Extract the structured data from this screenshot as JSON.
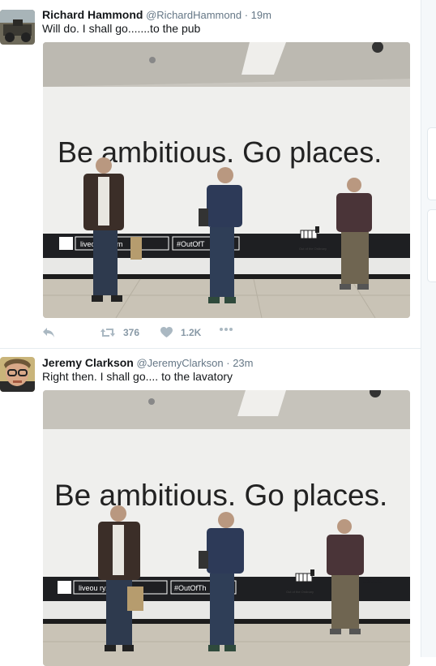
{
  "tweets": [
    {
      "fullname": "Richard Hammond",
      "username": "@RichardHammond",
      "separator": "·",
      "time": "19m",
      "text": "Will do. I shall go.......to the pub",
      "photo_sign_text": "Be ambitious. Go places.",
      "photo_panel_text": "liveou    ry.com",
      "photo_hashtag_text": "#OutOfT",
      "photo_brand_text": "estec",
      "photo_brand_tagline": "Out of the Ordinary",
      "actions": {
        "reply_icon": "reply-icon",
        "retweet_icon": "retweet-icon",
        "retweet_count": "376",
        "like_icon": "heart-icon",
        "like_count": "1.2K",
        "more_icon": "more-dots-icon"
      }
    },
    {
      "fullname": "Jeremy Clarkson",
      "username": "@JeremyClarkson",
      "separator": "·",
      "time": "23m",
      "text": "Right then. I shall go.... to the lavatory",
      "photo_sign_text": "Be ambitious. Go places.",
      "photo_panel_text": "liveou    ry.com",
      "photo_hashtag_text": "#OutOfTh",
      "photo_brand_text": "estec",
      "photo_brand_tagline": "Out of the Ordinary"
    }
  ],
  "colors": {
    "name": "#14171a",
    "meta": "#657786",
    "action": "#8899a6",
    "divider": "#e6ecf0"
  }
}
